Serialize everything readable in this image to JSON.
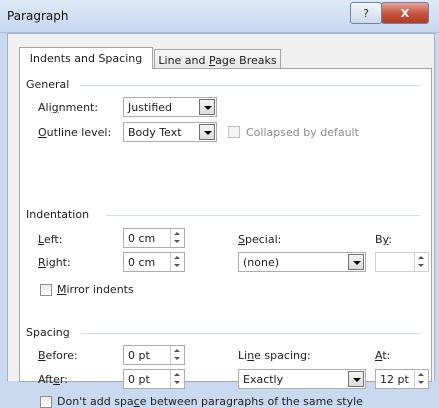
{
  "window": {
    "title": "Paragraph",
    "help_glyph": "?",
    "close_glyph": "X"
  },
  "tabs": [
    {
      "label": "Indents and Spacing"
    },
    {
      "label_pre": "Line and ",
      "label_ul": "P",
      "label_post": "age Breaks"
    }
  ],
  "general": {
    "heading": "General",
    "alignment": {
      "label_pre": "Ali",
      "label_ul": "g",
      "label_post": "nment:",
      "value": "Justified"
    },
    "outline": {
      "label_ul": "O",
      "label_post": "utline level:",
      "value": "Body Text"
    },
    "collapsed": {
      "label": "Collapsed by default",
      "checked": false
    }
  },
  "indentation": {
    "heading": "Indentation",
    "left": {
      "label_ul": "L",
      "label_post": "eft:",
      "value": "0 cm"
    },
    "right": {
      "label_ul": "R",
      "label_post": "ight:",
      "value": "0 cm"
    },
    "special": {
      "label_ul": "S",
      "label_post": "pecial:",
      "value": "(none)"
    },
    "by": {
      "label_pre": "B",
      "label_ul": "y",
      "label_post": ":",
      "value": ""
    },
    "mirror": {
      "label_ul": "M",
      "label_post": "irror indents",
      "checked": false
    }
  },
  "spacing": {
    "heading": "Spacing",
    "before": {
      "label_ul": "B",
      "label_post": "efore:",
      "value": "0 pt"
    },
    "after": {
      "label_pre": "Aft",
      "label_ul": "e",
      "label_post": "r:",
      "value": "0 pt"
    },
    "line_spacing": {
      "label_pre": "Li",
      "label_ul": "n",
      "label_post": "e spacing:",
      "value": "Exactly"
    },
    "at": {
      "label_ul": "A",
      "label_post": "t:",
      "value": "12 pt"
    },
    "dont_add": {
      "label_pre": "Don't add spa",
      "label_ul": "c",
      "label_post": "e between paragraphs of the same style",
      "checked": false
    }
  }
}
